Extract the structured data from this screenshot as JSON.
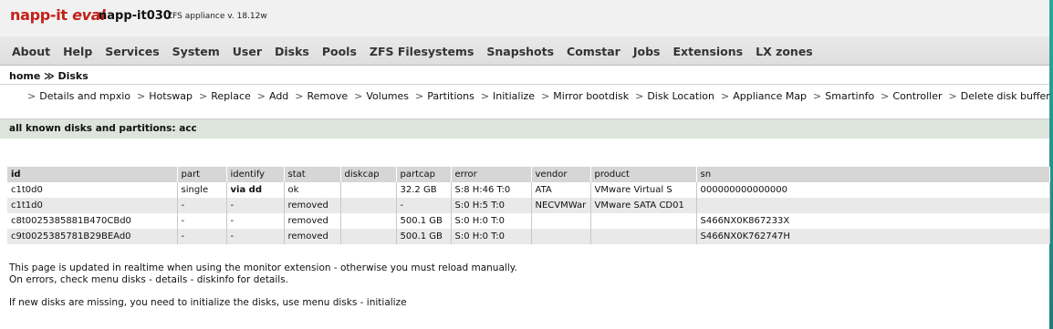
{
  "header": {
    "logo_main": "napp-it",
    "logo_eval": "eval",
    "hostname": "napp-it030",
    "version": "ZFS appliance v. 18.12w"
  },
  "menu": [
    "About",
    "Help",
    "Services",
    "System",
    "User",
    "Disks",
    "Pools",
    "ZFS Filesystems",
    "Snapshots",
    "Comstar",
    "Jobs",
    "Extensions",
    "LX zones"
  ],
  "breadcrumb": "home ≫ Disks",
  "submenu": [
    "Details and mpxio",
    "Hotswap",
    "Replace",
    "Add",
    "Remove",
    "Volumes",
    "Partitions",
    "Initialize",
    "Mirror bootdisk",
    "Disk Location",
    "Appliance Map",
    "Smartinfo",
    "Controller",
    "Delete disk buffer"
  ],
  "section_title": "all known disks and partitions: acc",
  "table": {
    "columns": [
      "id",
      "part",
      "identify",
      "stat",
      "diskcap",
      "partcap",
      "error",
      "vendor",
      "product",
      "sn"
    ],
    "rows": [
      [
        "c1t0d0",
        "single",
        "via dd",
        "ok",
        "",
        "32.2 GB",
        "S:8 H:46 T:0",
        "ATA",
        "VMware Virtual S",
        "000000000000000"
      ],
      [
        "c1t1d0",
        "-",
        "-",
        "removed",
        "",
        "-",
        "S:0 H:5 T:0",
        "NECVMWar",
        "VMware SATA CD01",
        ""
      ],
      [
        "c8t0025385881B470CBd0",
        "-",
        "-",
        "removed",
        "",
        "500.1 GB",
        "S:0 H:0 T:0",
        "",
        "",
        "S466NX0K867233X"
      ],
      [
        "c9t0025385781B29BEAd0",
        "-",
        "-",
        "removed",
        "",
        "500.1 GB",
        "S:0 H:0 T:0",
        "",
        "",
        "S466NX0K762747H"
      ]
    ]
  },
  "footer": {
    "line1": "This page is updated in realtime when using the monitor extension - otherwise you must reload manually.",
    "line2": "On errors, check menu disks - details - diskinfo for details.",
    "line3": "If new disks are missing, you need to initialize the disks, use menu disks - initialize"
  },
  "colors": {
    "logo_red": "#c4201a",
    "removed_red": "#cc1111",
    "section_bar": "#dde4dc",
    "header_bg": "#d6d6d6"
  }
}
